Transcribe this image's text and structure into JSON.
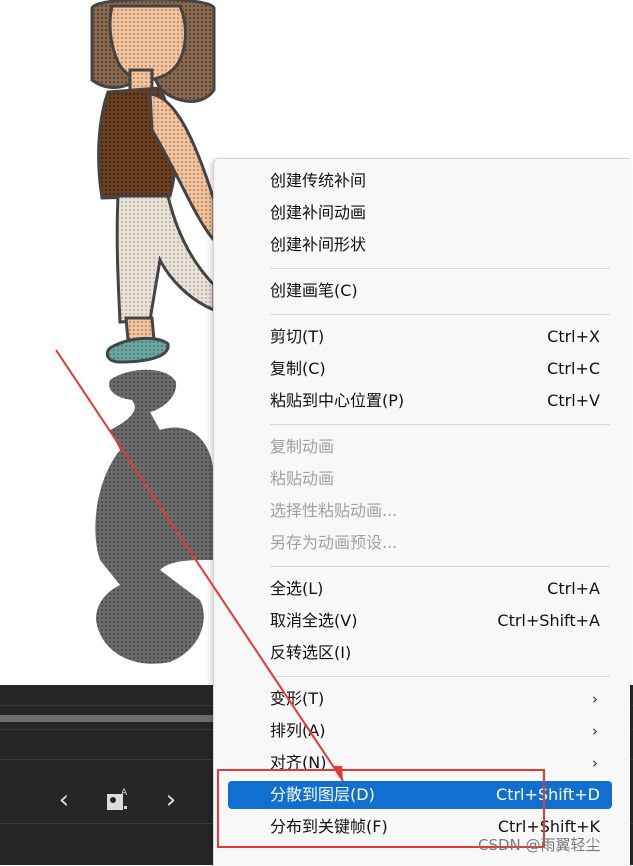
{
  "menu": {
    "groups": [
      [
        {
          "label": "创建传统补间",
          "shortcut": "",
          "submenu": false,
          "disabled": false
        },
        {
          "label": "创建补间动画",
          "shortcut": "",
          "submenu": false,
          "disabled": false
        },
        {
          "label": "创建补间形状",
          "shortcut": "",
          "submenu": false,
          "disabled": false
        }
      ],
      [
        {
          "label": "创建画笔(C)",
          "shortcut": "",
          "submenu": false,
          "disabled": false
        }
      ],
      [
        {
          "label": "剪切(T)",
          "shortcut": "Ctrl+X",
          "submenu": false,
          "disabled": false
        },
        {
          "label": "复制(C)",
          "shortcut": "Ctrl+C",
          "submenu": false,
          "disabled": false
        },
        {
          "label": "粘贴到中心位置(P)",
          "shortcut": "Ctrl+V",
          "submenu": false,
          "disabled": false
        }
      ],
      [
        {
          "label": "复制动画",
          "shortcut": "",
          "submenu": false,
          "disabled": true
        },
        {
          "label": "粘贴动画",
          "shortcut": "",
          "submenu": false,
          "disabled": true
        },
        {
          "label": "选择性粘贴动画...",
          "shortcut": "",
          "submenu": false,
          "disabled": true
        },
        {
          "label": "另存为动画预设...",
          "shortcut": "",
          "submenu": false,
          "disabled": true
        }
      ],
      [
        {
          "label": "全选(L)",
          "shortcut": "Ctrl+A",
          "submenu": false,
          "disabled": false
        },
        {
          "label": "取消全选(V)",
          "shortcut": "Ctrl+Shift+A",
          "submenu": false,
          "disabled": false
        },
        {
          "label": "反转选区(I)",
          "shortcut": "",
          "submenu": false,
          "disabled": false
        }
      ],
      [
        {
          "label": "变形(T)",
          "shortcut": "",
          "submenu": true,
          "disabled": false
        },
        {
          "label": "排列(A)",
          "shortcut": "",
          "submenu": true,
          "disabled": false
        },
        {
          "label": "对齐(N)",
          "shortcut": "",
          "submenu": true,
          "disabled": false
        },
        {
          "label": "分散到图层(D)",
          "shortcut": "Ctrl+Shift+D",
          "submenu": false,
          "disabled": false,
          "highlighted": true
        },
        {
          "label": "分布到关键帧(F)",
          "shortcut": "Ctrl+Shift+K",
          "submenu": false,
          "disabled": false
        }
      ]
    ],
    "submenu_glyph": "›"
  },
  "timeline": {
    "prev_glyph": "‹",
    "next_glyph": "›",
    "icons": [
      "prev-frame-icon",
      "onion-skin-icon",
      "next-frame-icon"
    ]
  },
  "watermark": "CSDN @雨翼轻尘",
  "colors": {
    "highlight": "#1170cf",
    "annotation": "#e53935",
    "timeline_bg": "#262626",
    "menu_bg": "#f8f8f8"
  }
}
